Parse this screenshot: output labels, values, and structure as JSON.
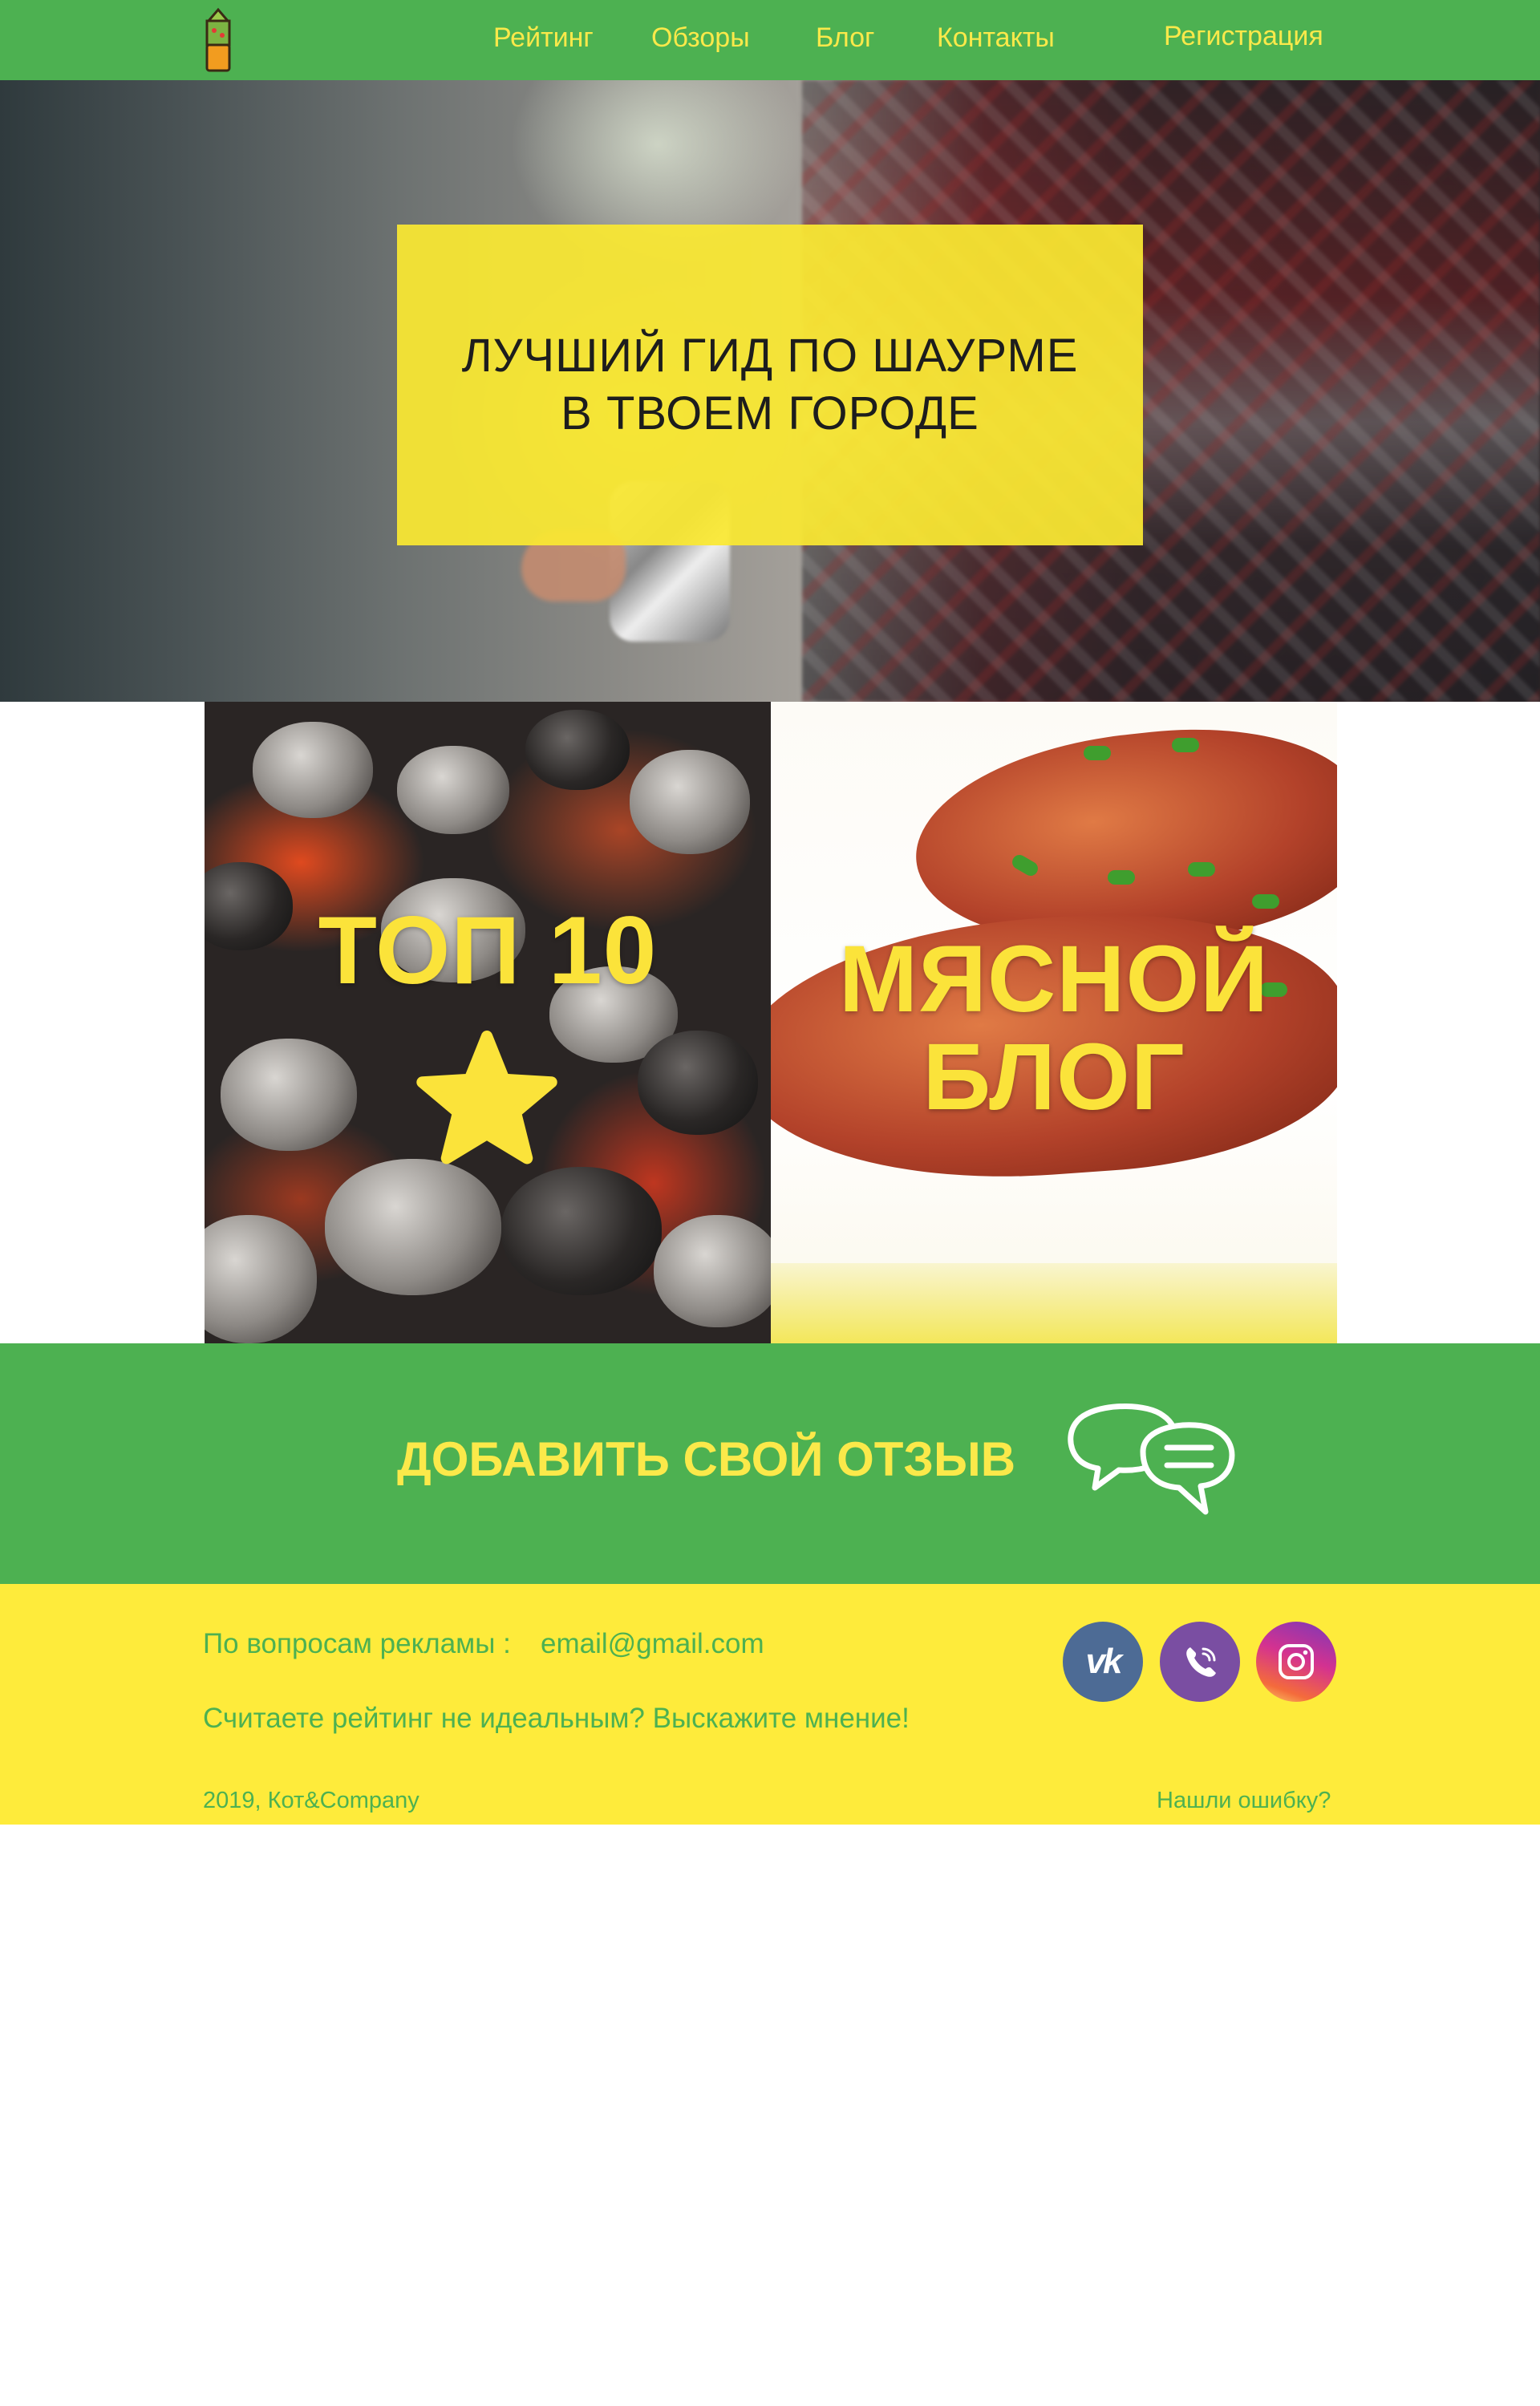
{
  "header": {
    "nav": [
      {
        "label": "Рейтинг"
      },
      {
        "label": "Обзоры"
      },
      {
        "label": "Блог"
      },
      {
        "label": "Контакты"
      }
    ],
    "register_label": "Регистрация"
  },
  "hero": {
    "line1": "ЛУЧШИЙ ГИД ПО ШАУРМЕ",
    "line2": "В ТВОЕМ ГОРОДЕ"
  },
  "cards": {
    "top10": {
      "title": "ТОП 10"
    },
    "blog": {
      "line1": "МЯСНОЙ",
      "line2": "БЛОГ"
    }
  },
  "review": {
    "label": "ДОБАВИТЬ СВОЙ ОТЗЫВ"
  },
  "footer": {
    "ads_label": "По вопросам рекламы :",
    "email": "email@gmail.com",
    "feedback": "Считаете рейтинг не идеальным? Выскажите мнение!",
    "copyright": "2019, Кот&Company",
    "report_error": "Нашли ошибку?"
  },
  "social": {
    "vk_text": "vk",
    "icons": [
      "vk-icon",
      "viber-icon",
      "instagram-icon"
    ]
  },
  "colors": {
    "green": "#4db151",
    "yellow": "#feeb3b",
    "text_yellow": "#fbe94a"
  }
}
